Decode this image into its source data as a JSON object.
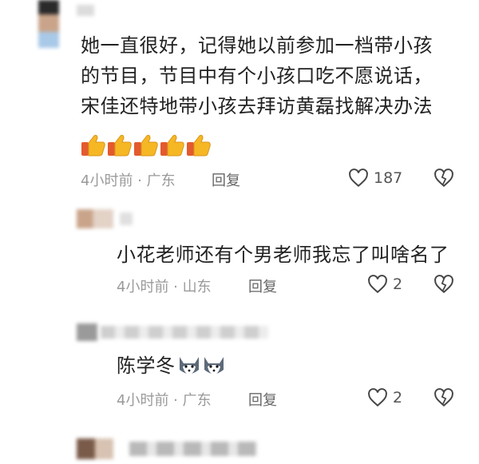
{
  "comments": [
    {
      "text_lines": [
        "她一直很好，记得她以前参加一档带小孩",
        "的节目，节目中有个小孩口吃不愿说话，",
        "宋佳还特地带小孩去拜访黄磊找解决办法"
      ],
      "emoji": "👍👍👍👍👍",
      "meta": "4小时前 · 广东",
      "reply_label": "回复",
      "likes": "187"
    },
    {
      "text": "小花老师还有个男老师我忘了叫啥名了",
      "meta": "4小时前 · 山东",
      "reply_label": "回复",
      "likes": "2"
    },
    {
      "text": "陈学冬",
      "meta": "4小时前 · 广东",
      "reply_label": "回复",
      "likes": "2"
    }
  ],
  "colors": {
    "avatar_tan": "#c9a48a",
    "avatar_dark": "#2a2a2a",
    "avatar_blue": "#a9c9e8",
    "name_gray": "#cfcfcf"
  }
}
